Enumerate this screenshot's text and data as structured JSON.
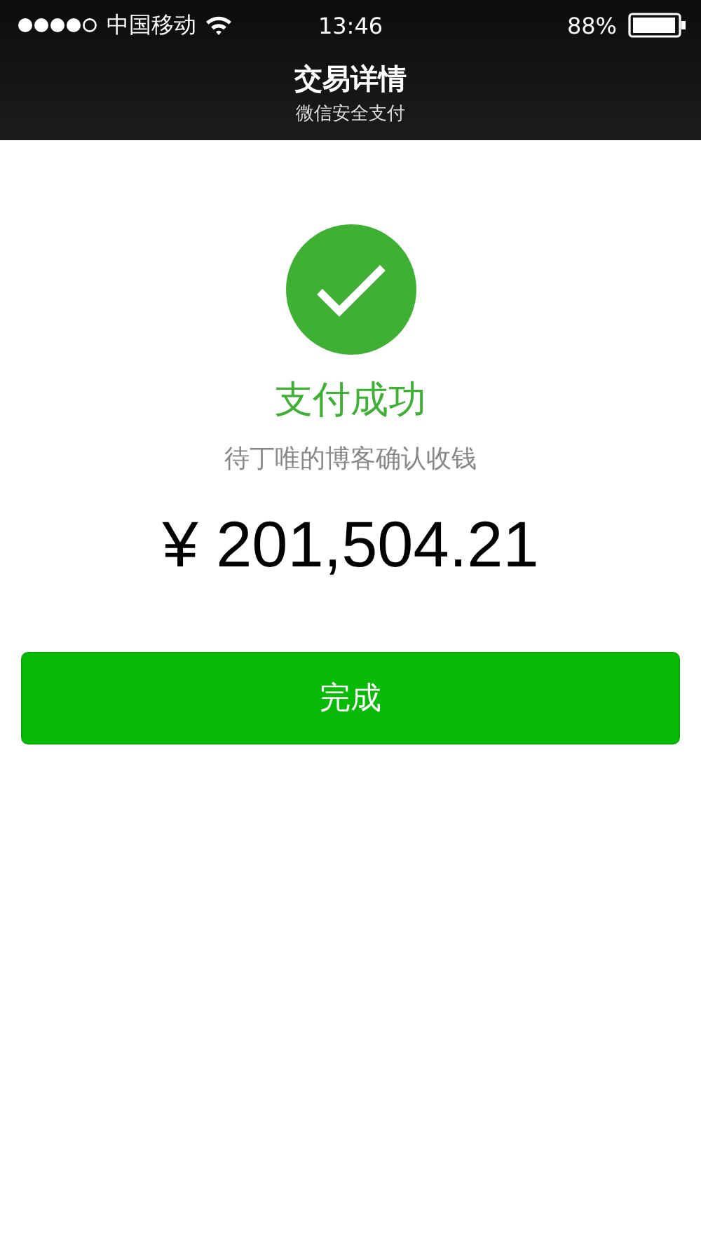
{
  "status_bar": {
    "carrier": "中国移动",
    "time": "13:46",
    "battery": "88%"
  },
  "nav_bar": {
    "title": "交易详情",
    "subtitle": "微信安全支付"
  },
  "result": {
    "title": "支付成功",
    "message": "待丁唯的博客确认收钱",
    "amount": "¥ 201,504.21"
  },
  "buttons": [
    "完成"
  ]
}
